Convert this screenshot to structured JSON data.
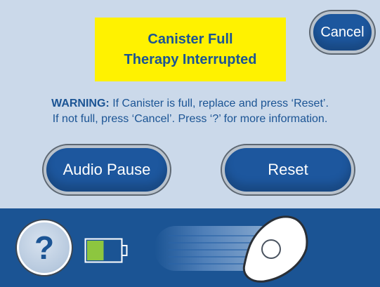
{
  "alert": {
    "line1": "Canister Full",
    "line2": "Therapy Interrupted",
    "background_color": "#fff200",
    "text_color": "#1b5494"
  },
  "buttons": {
    "cancel_label": "Cancel",
    "audio_pause_label": "Audio Pause",
    "reset_label": "Reset",
    "help_label": "?"
  },
  "warning": {
    "label": "WARNING:",
    "line1": " If Canister is full, replace and press ‘Reset’.",
    "line2": "If not full, press ‘Cancel’.  Press ‘?’ for more information."
  },
  "status_bar": {
    "battery_level": 0.5,
    "battery_color": "#8dc63f",
    "icons": [
      "help-icon",
      "battery-icon",
      "slide-lock-icon"
    ]
  },
  "colors": {
    "background": "#cbd9ea",
    "accent": "#1b5494",
    "button": "#1d579e"
  }
}
